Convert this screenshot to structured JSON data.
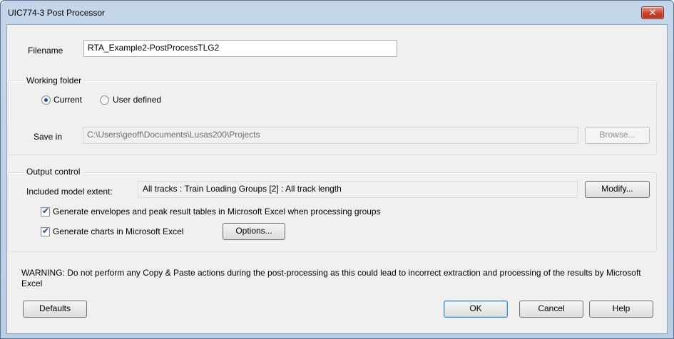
{
  "window": {
    "title": "UIC774-3 Post Processor"
  },
  "filename": {
    "label": "Filename",
    "value": "RTA_Example2-PostProcessTLG2"
  },
  "working_folder": {
    "title": "Working folder",
    "radio_current": "Current",
    "radio_user_defined": "User defined",
    "selected": "Current",
    "save_in_label": "Save in",
    "save_in_value": "C:\\Users\\geoff\\Documents\\Lusas200\\Projects",
    "browse_label": "Browse..."
  },
  "output_control": {
    "title": "Output control",
    "extent_label": "Included model extent:",
    "extent_value": "All tracks : Train Loading Groups [2] : All track length",
    "modify_label": "Modify...",
    "generate_envelopes_label": "Generate envelopes and peak result tables in Microsoft Excel when processing groups",
    "generate_envelopes_checked": true,
    "generate_charts_label": "Generate charts in Microsoft Excel",
    "generate_charts_checked": true,
    "options_label": "Options..."
  },
  "warning": "WARNING: Do not perform any Copy & Paste actions during the post-processing as this could lead to incorrect extraction and processing of the results by Microsoft Excel",
  "buttons": {
    "defaults": "Defaults",
    "ok": "OK",
    "cancel": "Cancel",
    "help": "Help"
  }
}
